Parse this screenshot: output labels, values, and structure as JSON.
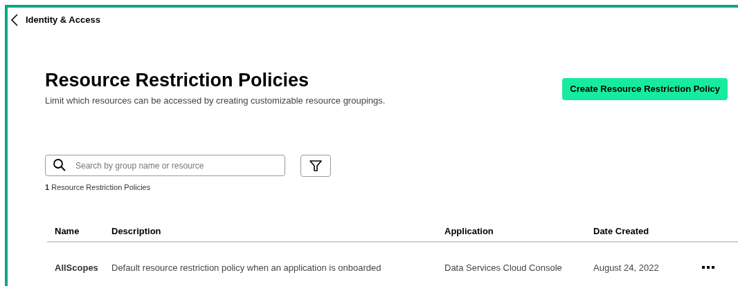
{
  "back_link": {
    "label": "Identity & Access"
  },
  "page": {
    "title": "Resource Restriction Policies",
    "subtitle": "Limit which resources can be accessed by creating customizable resource groupings."
  },
  "create_button": {
    "label": "Create Resource Restriction Policy"
  },
  "search": {
    "placeholder": "Search by group name or resource"
  },
  "result_count": "**1** Resource Restriction Policies",
  "table": {
    "columns": [
      "Name",
      "Description",
      "Application",
      "Date Created"
    ],
    "rows": [
      {
        "cells": [
          "AllScopes",
          "Default resource restriction policy when an application is onboarded",
          "Data Services Cloud Console",
          "August 24, 2022"
        ]
      }
    ]
  }
}
